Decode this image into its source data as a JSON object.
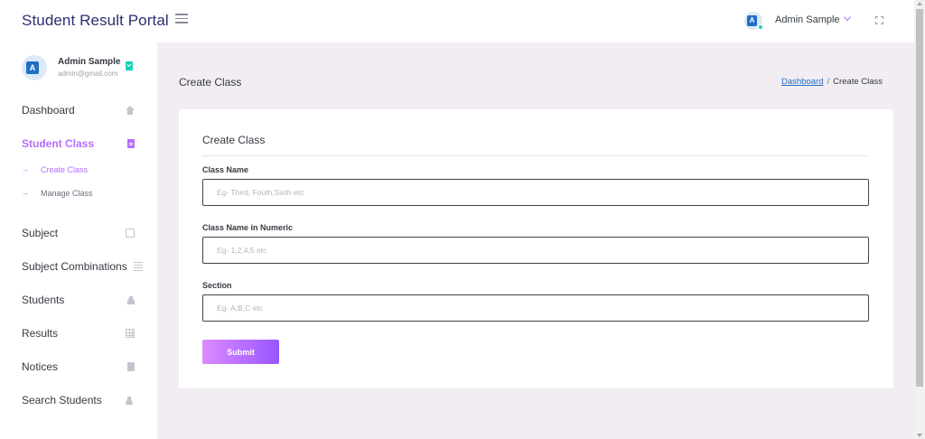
{
  "brand": {
    "title": "Student Result Portal"
  },
  "header": {
    "user_name": "Admin Sample",
    "avatar_letter": "A"
  },
  "sidebar": {
    "profile": {
      "name": "Admin Sample",
      "email": "admin@gmail.com",
      "avatar_letter": "A"
    },
    "items": [
      {
        "label": "Dashboard",
        "icon": "home-icon"
      },
      {
        "label": "Student Class",
        "icon": "document-icon",
        "active": true
      },
      {
        "label": "Subject",
        "icon": "book-icon"
      },
      {
        "label": "Subject Combinations",
        "icon": "list-icon"
      },
      {
        "label": "Students",
        "icon": "users-icon"
      },
      {
        "label": "Results",
        "icon": "grid-icon"
      },
      {
        "label": "Notices",
        "icon": "note-icon"
      },
      {
        "label": "Search Students",
        "icon": "search-user-icon"
      }
    ],
    "sub_items": [
      {
        "label": "Create Class",
        "active": true
      },
      {
        "label": "Manage Class"
      }
    ],
    "sub_arrow": "→"
  },
  "main": {
    "page_title": "Create Class",
    "breadcrumb": {
      "link": "Dashboard",
      "separator": "/",
      "current": "Create Class"
    },
    "form": {
      "title": "Create Class",
      "fields": [
        {
          "label": "Class Name",
          "placeholder": "Eg- Third, Fouth,Sixth etc",
          "value": ""
        },
        {
          "label": "Class Name in Numeric",
          "placeholder": "Eg- 1,2,4,5 etc",
          "value": ""
        },
        {
          "label": "Section",
          "placeholder": "Eg- A,B,C etc",
          "value": ""
        }
      ],
      "submit_label": "Submit"
    }
  },
  "colors": {
    "accent": "#b66dff",
    "brand_text": "#2c2e6e",
    "status_online": "#1bcfb4",
    "background": "#f2edf3"
  }
}
